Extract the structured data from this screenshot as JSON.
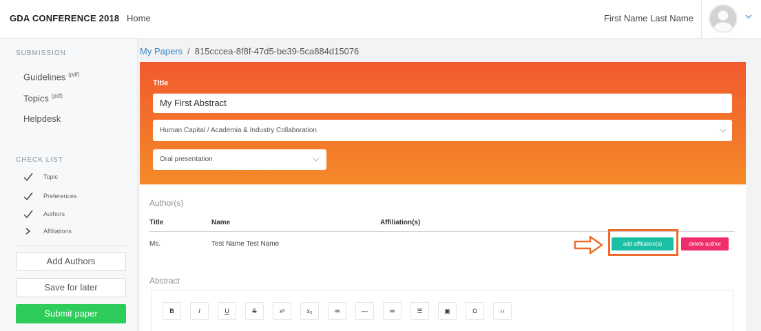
{
  "header": {
    "brand": "GDA CONFERENCE 2018",
    "nav_home": "Home",
    "user_name": "First Name Last Name"
  },
  "sidebar": {
    "submission_label": "SUBMISSION",
    "links": [
      {
        "label": "Guidelines",
        "sup": "(pdf)"
      },
      {
        "label": "Topics",
        "sup": "(pdf)"
      },
      {
        "label": "Helpdesk",
        "sup": ""
      }
    ],
    "checklist_label": "CHECK LIST",
    "checklist": [
      {
        "label": "Topic",
        "state": "done"
      },
      {
        "label": "Preferences",
        "state": "done"
      },
      {
        "label": "Authors",
        "state": "done"
      },
      {
        "label": "Affiliations",
        "state": "current"
      }
    ],
    "add_authors": "Add Authors",
    "save_later": "Save for later",
    "submit": "Submit paper"
  },
  "breadcrumb": {
    "parent": "My Papers",
    "separator": "/",
    "current": "815cccea-8f8f-47d5-be39-5ca884d15076"
  },
  "paper_form": {
    "title_label": "Title",
    "title_value": "My First Abstract",
    "topic_value": "Human Capital / Academia & Industry Collaboration",
    "presentation_value": "Oral presentation"
  },
  "authors": {
    "heading": "Author(s)",
    "columns": [
      "Title",
      "Name",
      "Affiliation(s)"
    ],
    "rows": [
      {
        "title": "Ms.",
        "name": "Test Name Test Name",
        "affiliations": ""
      }
    ],
    "add_affiliation_label": "add affiliation(s)",
    "delete_author_label": "delete author"
  },
  "abstract": {
    "heading": "Abstract",
    "toolbar": [
      {
        "icon": "bold-icon",
        "glyph": "B"
      },
      {
        "icon": "italic-icon",
        "glyph": "I"
      },
      {
        "icon": "underline-icon",
        "glyph": "U"
      },
      {
        "icon": "strikethrough-icon",
        "glyph": "S"
      },
      {
        "icon": "superscript-icon",
        "glyph": "x²"
      },
      {
        "icon": "subscript-icon",
        "glyph": "x₂"
      },
      {
        "icon": "bullet-list-icon",
        "glyph": "≔"
      },
      {
        "icon": "horizontal-rule-icon",
        "glyph": "—"
      },
      {
        "icon": "ordered-list-icon",
        "glyph": "≔"
      },
      {
        "icon": "align-icon",
        "glyph": "☰"
      },
      {
        "icon": "image-icon",
        "glyph": "▣"
      },
      {
        "icon": "special-char-icon",
        "glyph": "Ω"
      },
      {
        "icon": "code-icon",
        "glyph": "‹›"
      }
    ]
  },
  "colors": {
    "accent_orange_top": "#f05a2d",
    "accent_orange_bottom": "#f58a2a",
    "submit_green": "#2ecc5a",
    "affiliation_teal": "#1bbfa3",
    "delete_pink": "#ef2d6b",
    "link_blue": "#3b82c4"
  }
}
